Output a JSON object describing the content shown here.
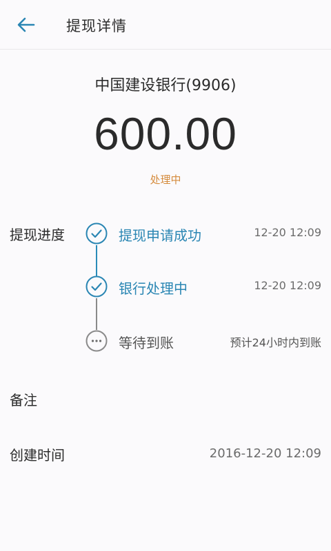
{
  "header": {
    "title": "提现详情",
    "back_icon": "arrow-left-icon",
    "accent": "#2a86b3"
  },
  "summary": {
    "bank": "中国建设银行(9906)",
    "amount": "600.00",
    "status": "处理中",
    "status_color": "#d58b3c"
  },
  "progress": {
    "label": "提现进度",
    "steps": [
      {
        "label": "提现申请成功",
        "time": "12-20 12:09",
        "state": "done",
        "icon": "check-circle-icon"
      },
      {
        "label": "银行处理中",
        "time": "12-20 12:09",
        "state": "done",
        "icon": "check-circle-icon"
      },
      {
        "label": "等待到账",
        "time": "预计24小时内到账",
        "state": "pending",
        "icon": "more-circle-icon"
      }
    ]
  },
  "remark": {
    "label": "备注"
  },
  "created": {
    "label": "创建时间",
    "value": "2016-12-20 12:09"
  }
}
